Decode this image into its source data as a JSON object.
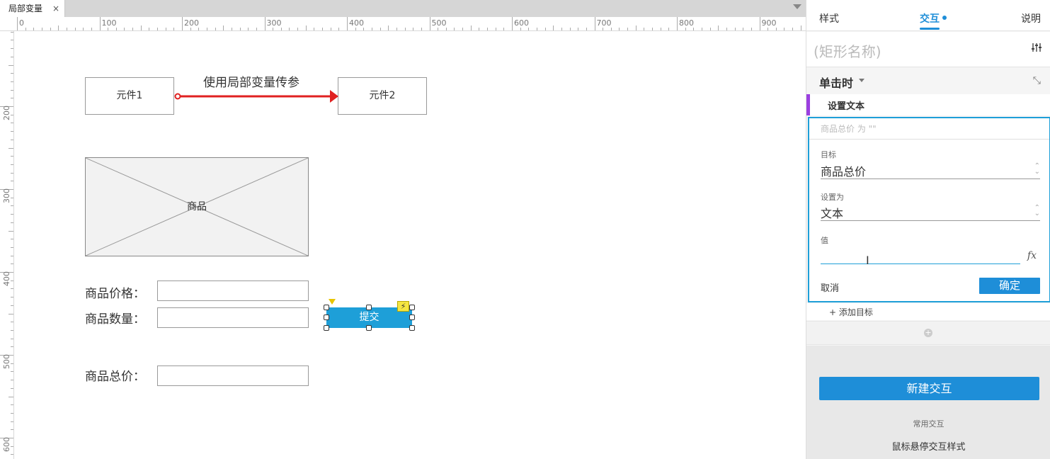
{
  "tab": {
    "title": "局部变量",
    "close": "×"
  },
  "ruler": {
    "h_labels": [
      "0",
      "100",
      "200",
      "300",
      "400",
      "500",
      "600",
      "700",
      "800",
      "900"
    ],
    "v_labels": [
      "200",
      "300",
      "400",
      "500",
      "600"
    ]
  },
  "canvas": {
    "component1": "元件1",
    "component2": "元件2",
    "arrow_label": "使用局部变量传参",
    "product_image_label": "商品",
    "price_label": "商品价格：",
    "quantity_label": "商品数量：",
    "total_label": "商品总价：",
    "submit_button": "提交",
    "flash_icon": "⚡"
  },
  "panel": {
    "tabs": {
      "style": "样式",
      "interactions": "交互",
      "notes": "说明"
    },
    "shape_name_placeholder": "(矩形名称)",
    "event": "单击时",
    "action": "设置文本",
    "summary": "商品总价 为 \"\"",
    "target_caption": "目标",
    "target_value": "商品总价",
    "set_as_caption": "设置为",
    "set_as_value": "文本",
    "value_caption": "值",
    "fx": "fx",
    "cancel": "取消",
    "ok": "确定",
    "add_target": "+ 添加目标",
    "new_interaction": "新建交互",
    "common_interactions": "常用交互",
    "hover_style": "鼠标悬停交互样式"
  },
  "colors": {
    "accent": "#1e8ed8",
    "submit_fill": "#1e9fd8",
    "arrow": "#e02020",
    "action_bar": "#9b3fe0"
  }
}
